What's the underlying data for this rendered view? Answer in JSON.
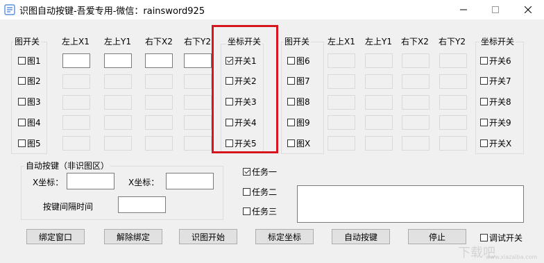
{
  "window": {
    "title": "识图自动按键-吾爱专用-微信：rainsword925",
    "minimize_icon": "minimize-icon",
    "maximize_icon": "maximize-icon",
    "close_icon": "close-icon"
  },
  "left_group": {
    "title": "图开关",
    "items": [
      "图1",
      "图2",
      "图3",
      "图4",
      "图5"
    ]
  },
  "left_coords": {
    "headers": [
      "左上X1",
      "左上Y1",
      "右下X2",
      "右下Y2"
    ]
  },
  "middle_group": {
    "title": "坐标开关",
    "items": [
      "开关1",
      "开关2",
      "开关3",
      "开关4",
      "开关5"
    ],
    "checked": [
      true,
      false,
      false,
      false,
      false
    ],
    "highlight_color": "#d6161c"
  },
  "right_pic_group": {
    "title": "图开关",
    "items": [
      "图6",
      "图7",
      "图8",
      "图9",
      "图X"
    ]
  },
  "right_coords": {
    "headers": [
      "左上X1",
      "左上Y1",
      "右下X2",
      "右下Y2"
    ]
  },
  "right_switch_group": {
    "title": "坐标开关",
    "items": [
      "开关6",
      "开关7",
      "开关8",
      "开关9",
      "开关X"
    ]
  },
  "auto_key": {
    "title": "自动按键（非识图区）",
    "x_label": "X坐标：",
    "y_label": "X坐标：",
    "interval_label": "按键间隔时间",
    "x_value": "",
    "y_value": "",
    "interval_value": ""
  },
  "tasks": {
    "items": [
      "任务一",
      "任务二",
      "任务三"
    ],
    "checked": [
      true,
      false,
      false
    ]
  },
  "buttons": {
    "bind": "绑定窗口",
    "unbind": "解除绑定",
    "start": "识图开始",
    "calibrate": "标定坐标",
    "auto": "自动按键",
    "stop": "停止"
  },
  "debug_switch": {
    "label": "调试开关",
    "checked": false
  },
  "watermark": {
    "text": "下载吧",
    "subtext": "www.xiazaiba.com"
  }
}
